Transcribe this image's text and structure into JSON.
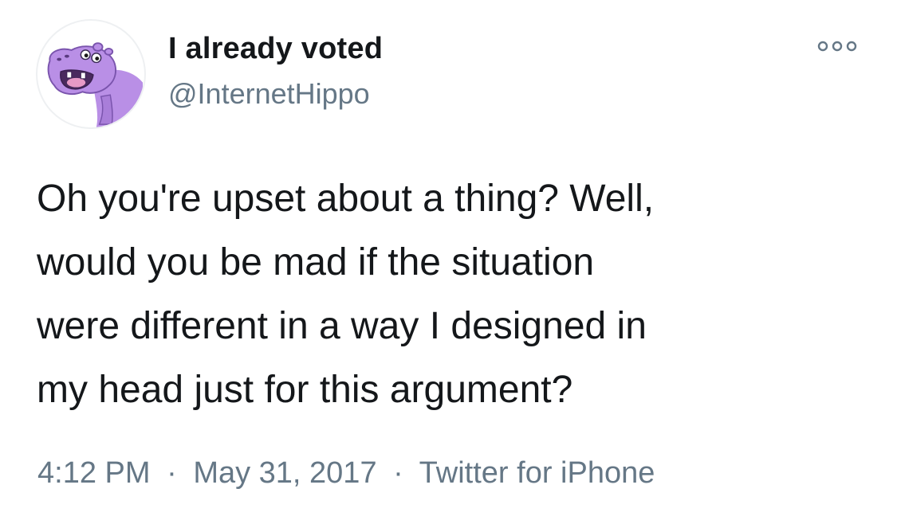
{
  "tweet": {
    "author": {
      "display_name": "I already voted",
      "handle": "@InternetHippo",
      "avatar_icon": "purple-hippo-avatar"
    },
    "more_icon": "ellipsis-icon",
    "text_lines": [
      "Oh you're upset about a thing? Well,",
      "would you be mad if the situation",
      "were different in a way I designed in",
      "my head just for this argument?"
    ],
    "meta": {
      "time": "4:12 PM",
      "date": "May 31, 2017",
      "separator": "·",
      "source": "Twitter for iPhone"
    }
  },
  "colors": {
    "text_primary": "#14171a",
    "text_secondary": "#657786",
    "avatar_purple": "#b98fe6",
    "background": "#ffffff"
  }
}
